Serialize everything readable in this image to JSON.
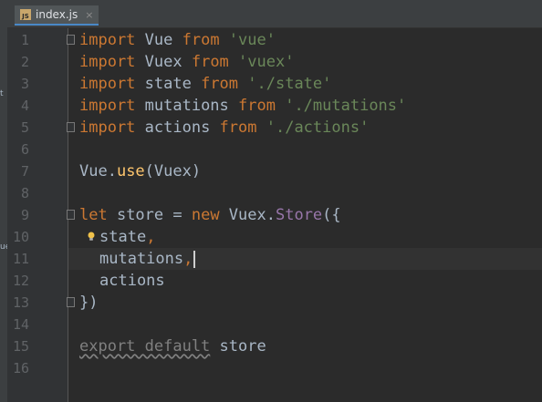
{
  "tab": {
    "icon": "js-file-icon",
    "badge": "JS",
    "label": "index.js",
    "close": "×"
  },
  "strip": {
    "mark_a": "t",
    "mark_b": "ue"
  },
  "gutter": {
    "line_numbers": [
      "1",
      "2",
      "3",
      "4",
      "5",
      "6",
      "7",
      "8",
      "9",
      "10",
      "11",
      "12",
      "13",
      "14",
      "15",
      "16"
    ]
  },
  "code": {
    "l1": {
      "kw": "import",
      "name": " Vue ",
      "kw2": "from",
      "str": " 'vue'"
    },
    "l2": {
      "kw": "import",
      "name": " Vuex ",
      "kw2": "from",
      "str": " 'vuex'"
    },
    "l3": {
      "kw": "import",
      "name": " state ",
      "kw2": "from",
      "str": " './state'"
    },
    "l4": {
      "kw": "import",
      "name": " mutations ",
      "kw2": "from",
      "str": " './mutations'"
    },
    "l5": {
      "kw": "import",
      "name": " actions ",
      "kw2": "from",
      "str": " './actions'"
    },
    "l7": {
      "obj": "Vue.",
      "fn": "use",
      "args": "(Vuex)"
    },
    "l9": {
      "kw": "let",
      "mid": " store = ",
      "kw2": "new",
      "obj": " Vuex.",
      "mth": "Store",
      "end": "({"
    },
    "l10": {
      "prop": "state",
      "comma": ","
    },
    "l11": {
      "prop": "mutations",
      "comma": ","
    },
    "l12": {
      "prop": "actions"
    },
    "l13": {
      "text": "})"
    },
    "l15": {
      "unused": "export default",
      "name": " store"
    }
  },
  "colors": {
    "keyword": "#cc7832",
    "string": "#6a8759",
    "function": "#ffc66d",
    "method": "#9876aa",
    "text": "#a9b7c6",
    "background": "#2b2b2b"
  }
}
